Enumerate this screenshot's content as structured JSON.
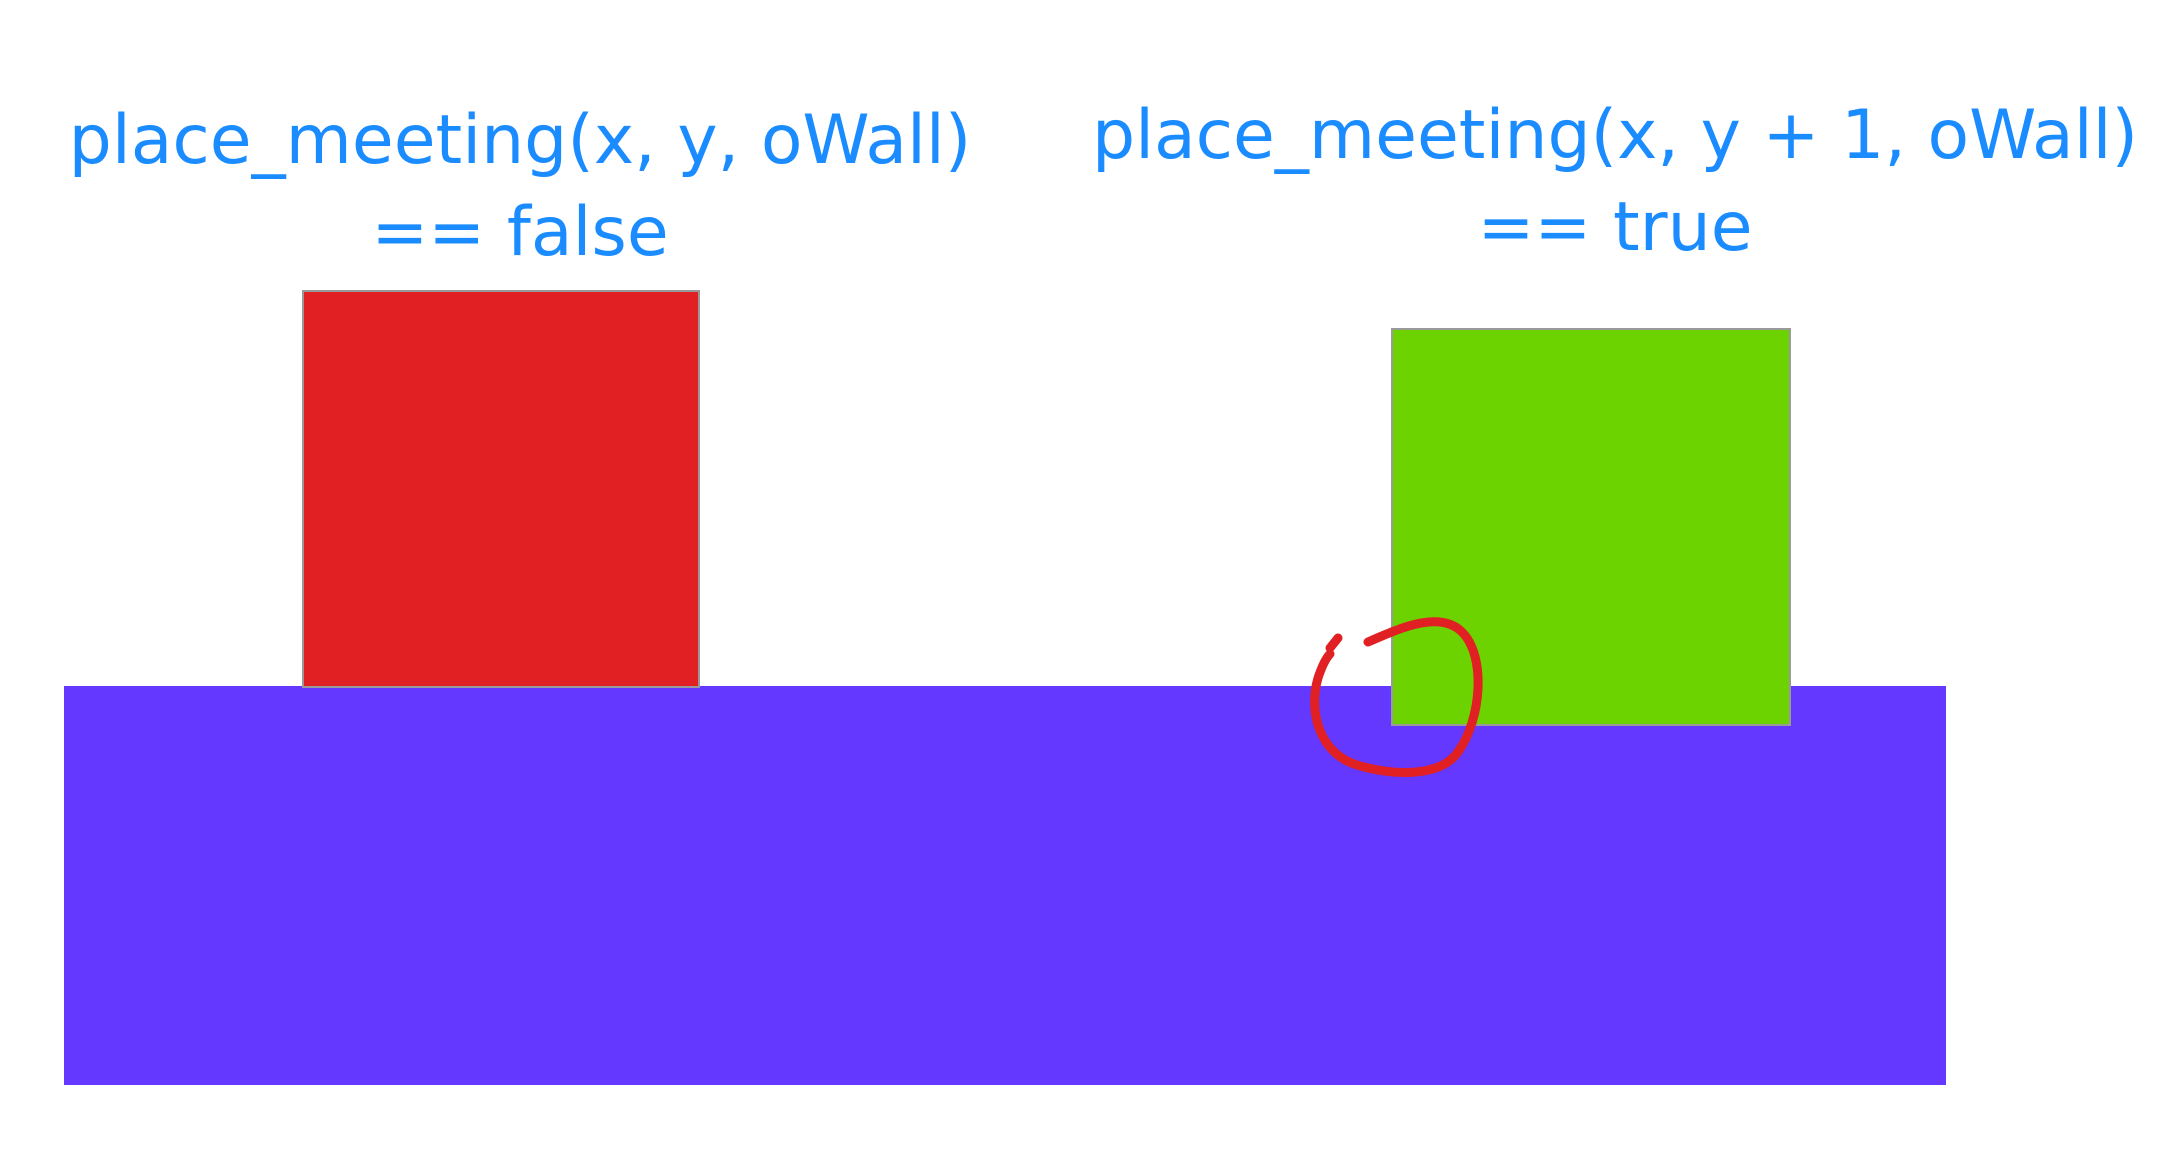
{
  "captions": {
    "left": {
      "line1": "place_meeting(x, y, oWall)",
      "line2": "== false"
    },
    "right": {
      "line1": "place_meeting(x, y + 1, oWall)",
      "line2": "== true"
    }
  },
  "colors": {
    "text": "#1a8cff",
    "wall": "#6438ff",
    "red_block": "#e02022",
    "green_block": "#6cd300",
    "highlight_stroke": "#e02022"
  }
}
